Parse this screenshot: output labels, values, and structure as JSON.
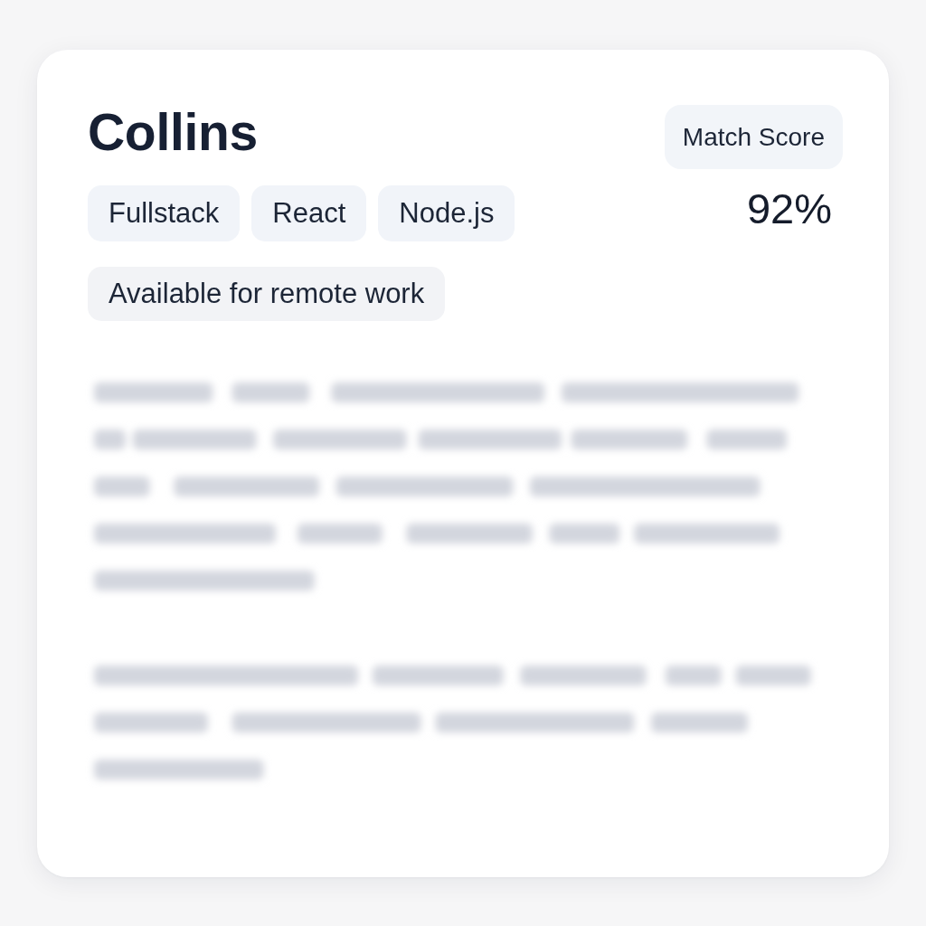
{
  "card": {
    "name": "Collins",
    "tags": [
      "Fullstack",
      "React",
      "Node.js"
    ],
    "availability": "Available for remote work",
    "match_score": {
      "label": "Match Score",
      "value": "92%"
    }
  }
}
